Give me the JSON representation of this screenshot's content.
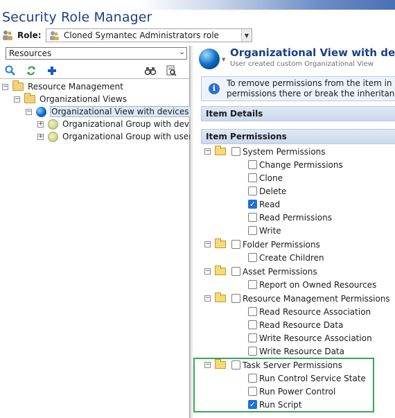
{
  "app": {
    "title": "Security Role Manager"
  },
  "role": {
    "label": "Role:",
    "value": "Cloned Symantec Administrators role"
  },
  "left": {
    "selector": "Resources",
    "toolbar": [
      "search-icon",
      "refresh-icon",
      "add-icon",
      "binoculars-icon",
      "find-icon"
    ],
    "tree": [
      {
        "label": "Resource Management",
        "expanded": true
      },
      {
        "label": "Organizational Views",
        "expanded": true
      },
      {
        "label": "Organizational View with devices for",
        "expanded": true,
        "selected": true
      },
      {
        "label": "Organizational Group with device",
        "expanded": false
      },
      {
        "label": "Organizational Group with users",
        "expanded": false
      }
    ]
  },
  "right": {
    "title": "Organizational View with devic",
    "subtitle": "User created custom Organizational View",
    "info_line1": "To remove permissions from the item in cas",
    "info_line2": "permissions there or break the inheritance l",
    "item_details": "Item Details",
    "item_permissions": "Item Permissions",
    "groups": [
      {
        "label": "System Permissions",
        "checked": false,
        "items": [
          {
            "label": "Change Permissions",
            "checked": false
          },
          {
            "label": "Clone",
            "checked": false
          },
          {
            "label": "Delete",
            "checked": false
          },
          {
            "label": "Read",
            "checked": true
          },
          {
            "label": "Read Permissions",
            "checked": false
          },
          {
            "label": "Write",
            "checked": false
          }
        ]
      },
      {
        "label": "Folder Permissions",
        "checked": false,
        "items": [
          {
            "label": "Create Children",
            "checked": false
          }
        ]
      },
      {
        "label": "Asset Permissions",
        "checked": false,
        "items": [
          {
            "label": "Report on Owned Resources",
            "checked": false
          }
        ]
      },
      {
        "label": "Resource Management Permissions",
        "checked": false,
        "items": [
          {
            "label": "Read Resource Association",
            "checked": false
          },
          {
            "label": "Read Resource Data",
            "checked": false
          },
          {
            "label": "Write Resource Association",
            "checked": false
          },
          {
            "label": "Write Resource Data",
            "checked": false
          }
        ]
      },
      {
        "label": "Task Server Permissions",
        "checked": false,
        "items": [
          {
            "label": "Run Control Service State",
            "checked": false
          },
          {
            "label": "Run Power Control",
            "checked": false
          },
          {
            "label": "Run Script",
            "checked": true
          }
        ]
      }
    ]
  }
}
